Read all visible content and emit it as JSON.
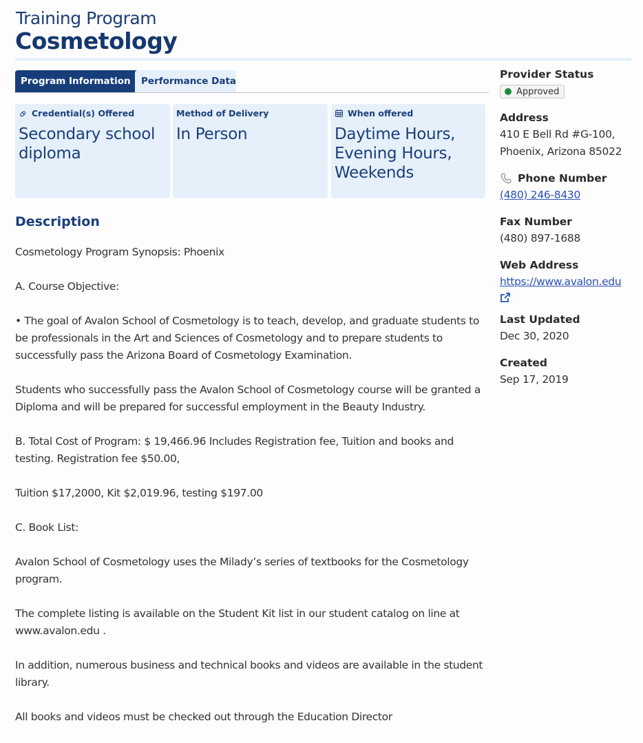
{
  "header": {
    "eyebrow": "Training Program",
    "title": "Cosmetology"
  },
  "tabs": [
    {
      "label": "Program Information",
      "active": true
    },
    {
      "label": "Performance Data",
      "active": false
    }
  ],
  "cards": [
    {
      "icon": "certificate-icon",
      "label": "Credential(s) Offered",
      "value": "Secondary school diploma"
    },
    {
      "icon": null,
      "label": "Method of Delivery",
      "value": "In Person"
    },
    {
      "icon": "calendar-icon",
      "label": "When offered",
      "value": "Daytime Hours, Evening Hours, Weekends"
    }
  ],
  "description": {
    "heading": "Description",
    "paragraphs": [
      "Cosmetology Program Synopsis: Phoenix",
      "A. Course Objective:",
      "• The goal of Avalon School of Cosmetology is to teach, develop, and graduate students to be professionals in the Art and Sciences of Cosmetology and to prepare students to successfully pass the Arizona Board of Cosmetology Examination.",
      "Students who successfully pass the Avalon School of Cosmetology course will be granted a Diploma and will be prepared for successful employment in the Beauty Industry.",
      "B. Total Cost of Program: $ 19,466.96 Includes Registration fee, Tuition and books and testing. Registration fee $50.00,",
      "Tuition $17,2000, Kit $2,019.96, testing $197.00",
      "C. Book List:",
      "Avalon School of Cosmetology uses the Milady’s series of textbooks for the Cosmetology program.",
      "The complete listing is available on the Student Kit list in our student catalog on line at www.avalon.edu .",
      "In addition, numerous business and technical books and videos are available in the student library.",
      "All books and videos must be checked out through the Education Director"
    ]
  },
  "sidebar": {
    "provider_status": {
      "label": "Provider Status",
      "value": "Approved",
      "status_color": "#1f8a3f"
    },
    "address": {
      "label": "Address",
      "line1": "410 E Bell Rd #G-100,",
      "line2": "Phoenix, Arizona 85022"
    },
    "phone": {
      "label": "Phone Number",
      "value": "(480) 246-8430"
    },
    "fax": {
      "label": "Fax Number",
      "value": "(480) 897-1688"
    },
    "web": {
      "label": "Web Address",
      "value": "https://www.avalon.edu"
    },
    "last_updated": {
      "label": "Last Updated",
      "value": "Dec 30, 2020"
    },
    "created": {
      "label": "Created",
      "value": "Sep 17, 2019"
    }
  },
  "colors": {
    "brand_navy": "#173e7b",
    "tint": "#e6f0fb",
    "link": "#2950b5"
  }
}
